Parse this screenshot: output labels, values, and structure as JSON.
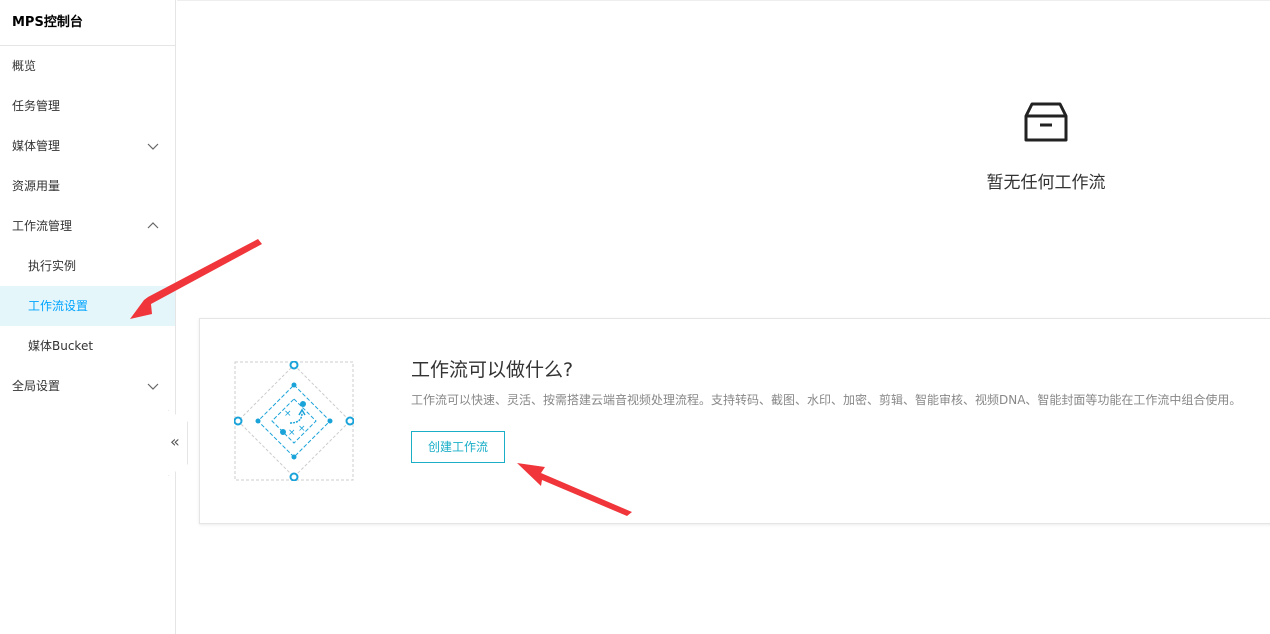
{
  "sidebar": {
    "title": "MPS控制台",
    "items": [
      {
        "label": "概览"
      },
      {
        "label": "任务管理"
      },
      {
        "label": "媒体管理"
      },
      {
        "label": "资源用量"
      },
      {
        "label": "工作流管理"
      },
      {
        "label": "执行实例"
      },
      {
        "label": "工作流设置"
      },
      {
        "label": "媒体Bucket"
      },
      {
        "label": "全局设置"
      }
    ],
    "collapse_icon": "double-chevron-left-icon"
  },
  "empty_state": {
    "icon": "archive-box-icon",
    "text": "暂无任何工作流"
  },
  "intro_card": {
    "title": "工作流可以做什么?",
    "description": "工作流可以快速、灵活、按需搭建云端音视频处理流程。支持转码、截图、水印、加密、剪辑、智能审核、视频DNA、智能封面等功能在工作流中组合使用。",
    "button_label": "创建工作流"
  },
  "colors": {
    "accent": "#00a4ff",
    "active_bg": "#e5f6fb",
    "button": "#1aaec7",
    "annotation": "#f0363b"
  }
}
